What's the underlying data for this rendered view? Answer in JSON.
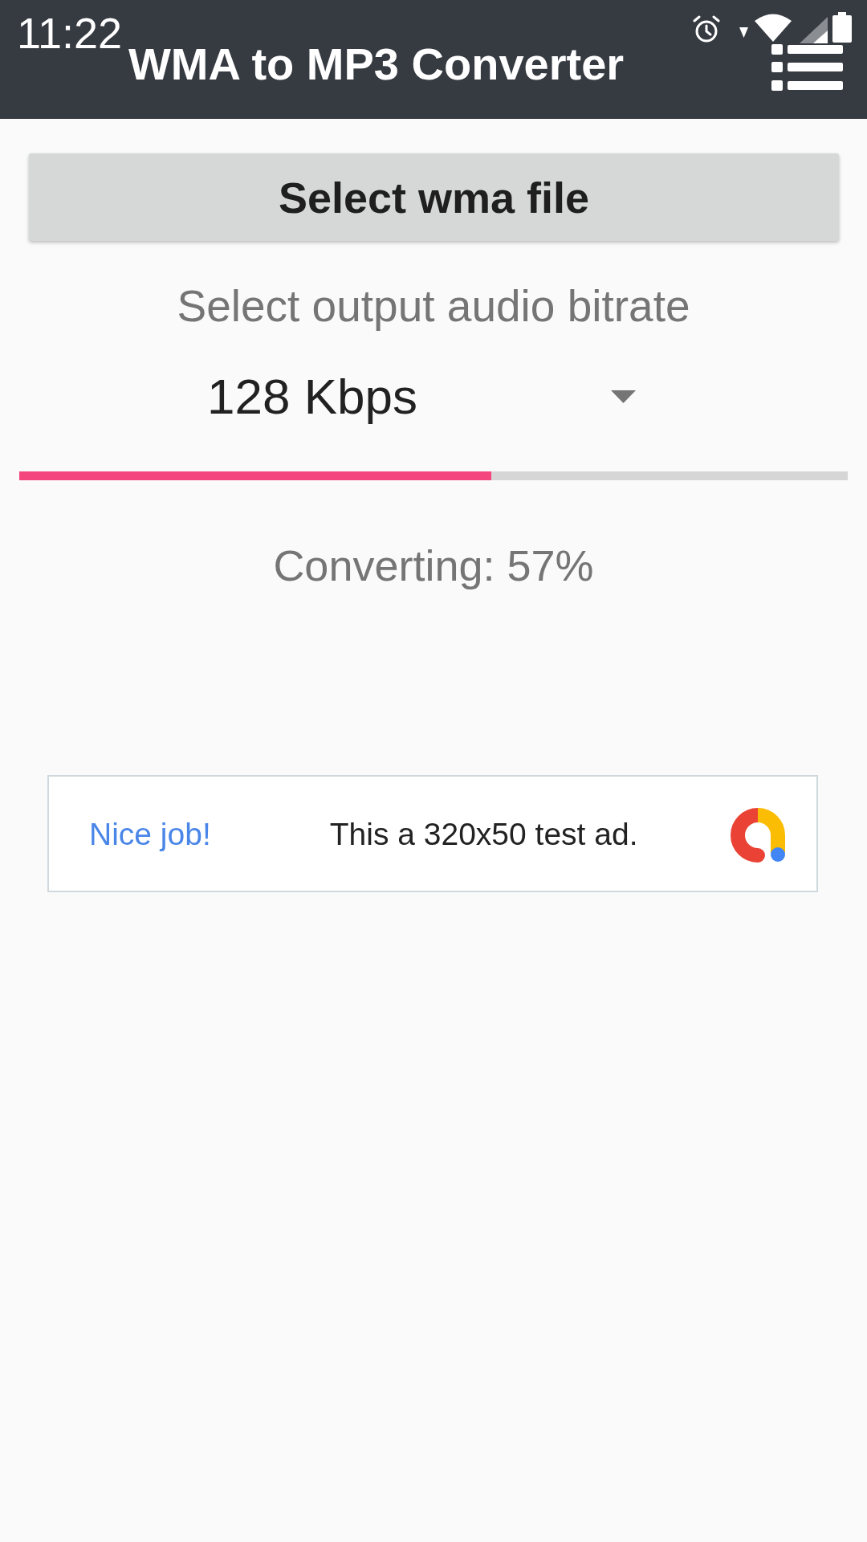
{
  "status_bar": {
    "time": "11:22"
  },
  "app_bar": {
    "title": "WMA to MP3 Converter"
  },
  "select_button": {
    "label": "Select wma file"
  },
  "bitrate": {
    "label": "Select output audio bitrate",
    "value": "128 Kbps"
  },
  "progress": {
    "level": 0.57
  },
  "status": {
    "text": "Converting: 57%"
  },
  "ad": {
    "headline": "Nice job!",
    "text": "This a 320x50 test ad."
  }
}
